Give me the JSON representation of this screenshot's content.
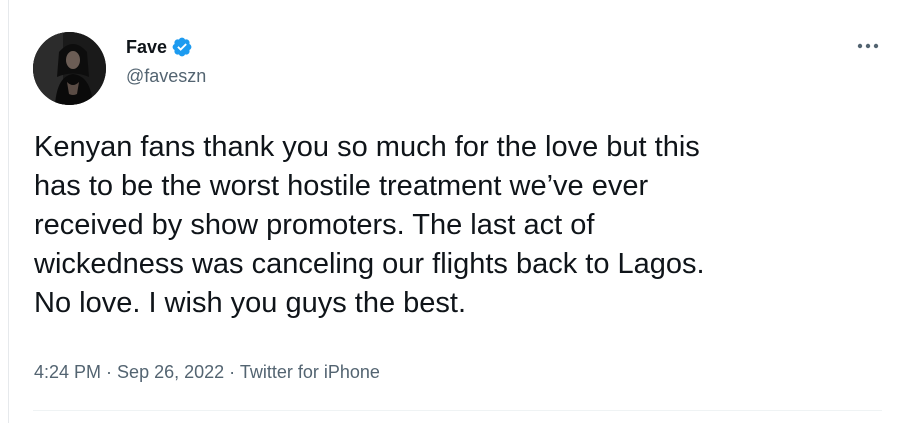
{
  "tweet": {
    "author_name": "Fave",
    "author_handle": "@faveszn",
    "verified": true,
    "text": "Kenyan fans thank you so much for the love but this\nhas to be the worst hostile treatment we’ve ever\nreceived by show promoters. The last act of\nwickedness was canceling our flights back to Lagos.\nNo love. I wish you guys the best.",
    "time": "4:24 PM",
    "separator": " · ",
    "date": "Sep 26, 2022",
    "source": "Twitter for iPhone",
    "more_icon": "more-options-icon"
  },
  "colors": {
    "verified_blue": "#1d9bf0",
    "text_primary": "#0f1419",
    "text_secondary": "#536471"
  }
}
